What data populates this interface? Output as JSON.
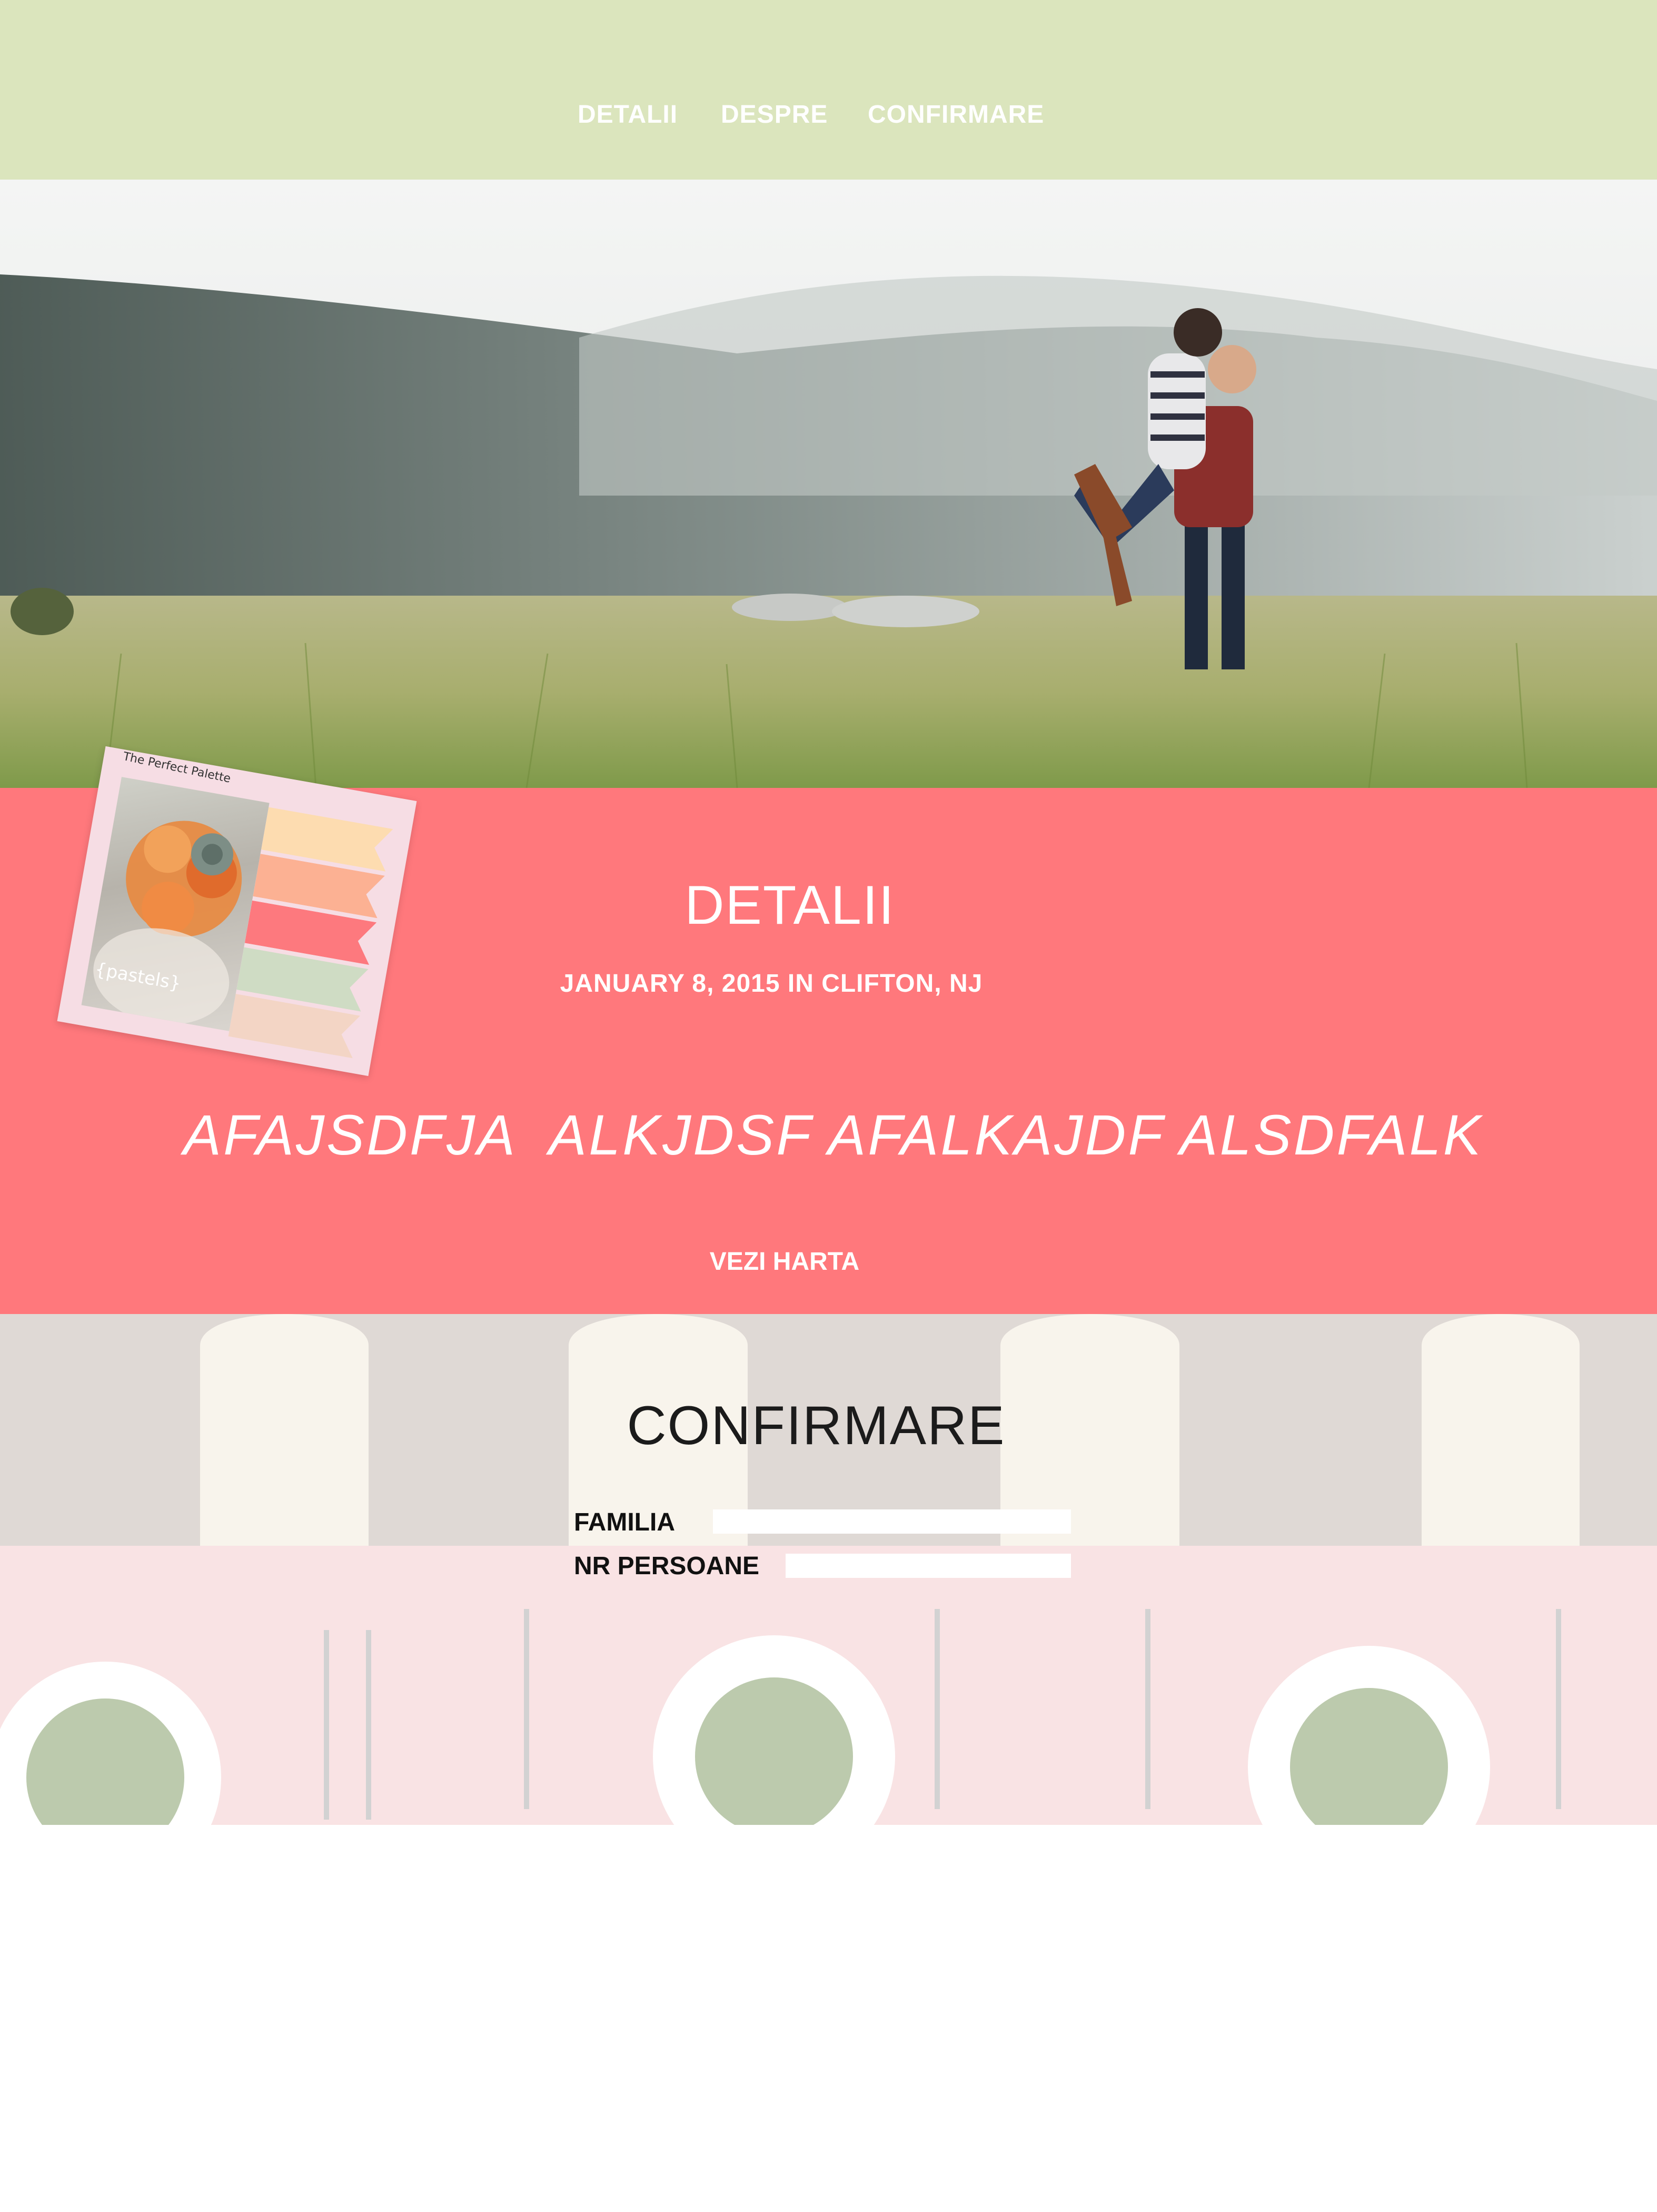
{
  "nav": {
    "items": [
      {
        "label": "DETALII"
      },
      {
        "label": "DESPRE"
      },
      {
        "label": "CONFIRMARE"
      }
    ]
  },
  "palette_card": {
    "title": "The Perfect Palette",
    "tag": "{pastels}",
    "swatches": [
      "#fddcb0",
      "#fcb193",
      "#fd797e",
      "#cfdcc4",
      "#f3d5c5"
    ]
  },
  "detalii": {
    "title": "DETALII",
    "date_location": "JANUARY 8, 2015 IN CLIFTON, NJ",
    "body": "AFAJSDFJA  ALKJDSF AFALKAJDF ALSDFALK",
    "map_link": "VEZI HARTA"
  },
  "confirmare": {
    "title": "CONFIRMARE",
    "fields": [
      {
        "label": "FAMILIA",
        "value": ""
      },
      {
        "label": "NR PERSOANE",
        "value": ""
      }
    ]
  },
  "colors": {
    "nav_bg": "#dbe5bd",
    "detalii_bg": "#ff787c",
    "text_light": "#ffffff"
  }
}
